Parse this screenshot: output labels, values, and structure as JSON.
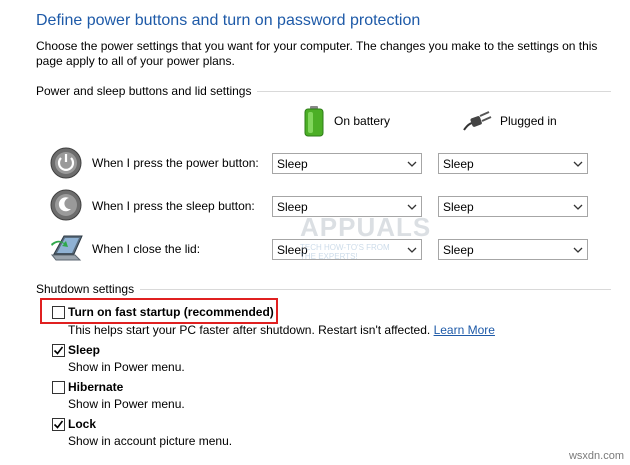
{
  "page": {
    "title": "Define power buttons and turn on password protection",
    "description": "Choose the power settings that you want for your computer. The changes you make to the settings on this page apply to all of your power plans."
  },
  "power_section": {
    "heading": "Power and sleep buttons and lid settings",
    "columns": {
      "on_battery": "On battery",
      "plugged_in": "Plugged in"
    },
    "rows": [
      {
        "label": "When I press the power button:",
        "battery": "Sleep",
        "plugged": "Sleep",
        "icon": "power-button-icon"
      },
      {
        "label": "When I press the sleep button:",
        "battery": "Sleep",
        "plugged": "Sleep",
        "icon": "sleep-button-icon"
      },
      {
        "label": "When I close the lid:",
        "battery": "Sleep",
        "plugged": "Sleep",
        "icon": "laptop-lid-icon"
      }
    ]
  },
  "shutdown_section": {
    "heading": "Shutdown settings",
    "fast_startup": {
      "label": "Turn on fast startup (recommended)",
      "checked": false,
      "description": "This helps start your PC faster after shutdown. Restart isn't affected.",
      "link": "Learn More"
    },
    "sleep": {
      "label": "Sleep",
      "checked": true,
      "description": "Show in Power menu."
    },
    "hibernate": {
      "label": "Hibernate",
      "checked": false,
      "description": "Show in Power menu."
    },
    "lock": {
      "label": "Lock",
      "checked": true,
      "description": "Show in account picture menu."
    }
  },
  "watermark": {
    "brand": "APPUALS",
    "tagline_1": "TECH HOW-TO'S FROM",
    "tagline_2": "THE EXPERTS!"
  },
  "footer_text": "wsxdn.com",
  "colors": {
    "title": "#1e5aa8",
    "highlight": "#e02020",
    "link": "#1e5aa8"
  }
}
